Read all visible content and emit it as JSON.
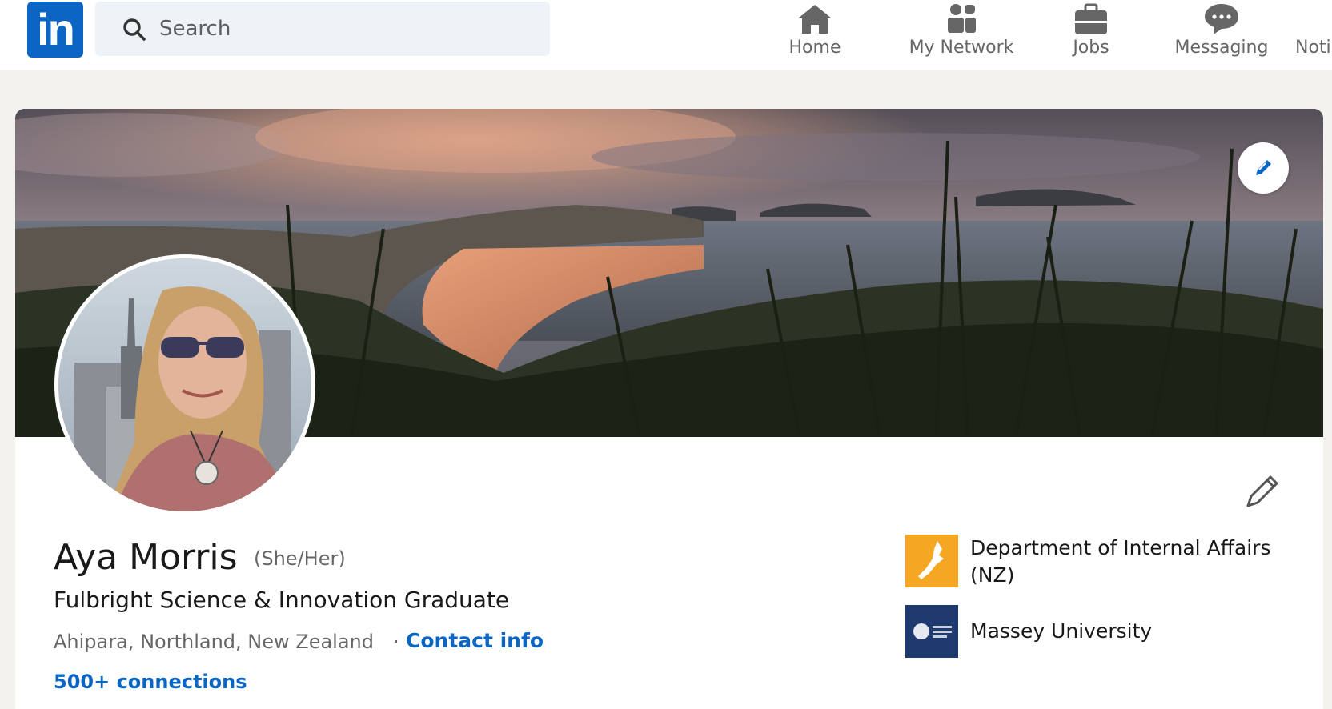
{
  "nav": {
    "search_placeholder": "Search",
    "items": [
      {
        "label": "Home",
        "icon": "home-icon"
      },
      {
        "label": "My Network",
        "icon": "people-icon"
      },
      {
        "label": "Jobs",
        "icon": "briefcase-icon"
      },
      {
        "label": "Messaging",
        "icon": "chat-icon"
      },
      {
        "label": "Noti",
        "icon": "bell-icon"
      }
    ],
    "logo": "in"
  },
  "profile": {
    "name": "Aya Morris",
    "pronouns": "(She/Her)",
    "headline": "Fulbright Science & Innovation Graduate",
    "location": "Ahipara, Northland, New Zealand",
    "separator": "·",
    "contact_info": "Contact info",
    "connections": "500+ connections"
  },
  "experience": [
    {
      "name": "Department of Internal Affairs (NZ)",
      "logo": "dia-nz-logo",
      "color": "#f5a623"
    },
    {
      "name": "Massey University",
      "logo": "massey-crest-logo",
      "color": "#1f3a6e"
    }
  ],
  "colors": {
    "brand": "#0a66c2",
    "page_bg": "#f3f2ef"
  }
}
